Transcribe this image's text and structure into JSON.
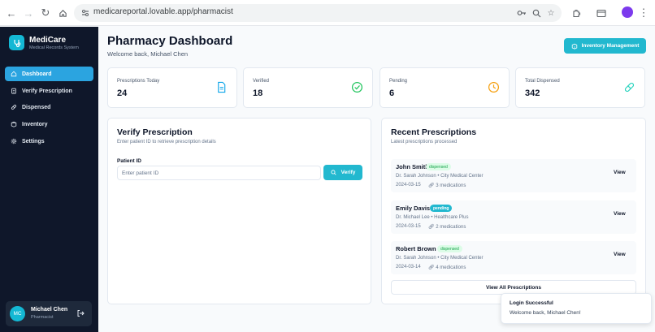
{
  "browser": {
    "url": "medicareportal.lovable.app/pharmacist"
  },
  "brand": {
    "name": "MediCare",
    "subtitle": "Medical Records System",
    "accent": "#22b8cf"
  },
  "sidebar": {
    "items": [
      {
        "label": "Dashboard",
        "icon": "home-icon",
        "active": true
      },
      {
        "label": "Verify Prescription",
        "icon": "clipboard-icon",
        "active": false
      },
      {
        "label": "Dispensed",
        "icon": "pill-icon",
        "active": false
      },
      {
        "label": "Inventory",
        "icon": "box-icon",
        "active": false
      },
      {
        "label": "Settings",
        "icon": "gear-icon",
        "active": false
      }
    ],
    "user": {
      "initials": "MC",
      "name": "Michael Chen",
      "role": "Pharmacist"
    }
  },
  "header": {
    "title": "Pharmacy Dashboard",
    "subtitle": "Welcome back, Michael Chen",
    "inventory_button": "Inventory Management"
  },
  "stats": [
    {
      "label": "Prescriptions Today",
      "value": "24",
      "icon": "document-icon",
      "color": "#0ea5e9"
    },
    {
      "label": "Verified",
      "value": "18",
      "icon": "check-circle-icon",
      "color": "#22c55e"
    },
    {
      "label": "Pending",
      "value": "6",
      "icon": "clock-icon",
      "color": "#f59e0b"
    },
    {
      "label": "Total Dispensed",
      "value": "342",
      "icon": "pill-icon",
      "color": "#2dd4bf"
    }
  ],
  "verify": {
    "title": "Verify Prescription",
    "subtitle": "Enter patient ID to retrieve prescription details",
    "field_label": "Patient ID",
    "placeholder": "Enter patient ID",
    "button": "Verify"
  },
  "recent": {
    "title": "Recent Prescriptions",
    "subtitle": "Latest prescriptions processed",
    "items": [
      {
        "patient": "John Smith",
        "status": "dispensed",
        "doctor": "Dr. Sarah Johnson • City Medical Center",
        "date": "2024-03-15",
        "meds": "3 medications",
        "view": "View"
      },
      {
        "patient": "Emily Davis",
        "status": "pending",
        "doctor": "Dr. Michael Lee • Healthcare Plus",
        "date": "2024-03-15",
        "meds": "2 medications",
        "view": "View"
      },
      {
        "patient": "Robert Brown",
        "status": "dispensed",
        "doctor": "Dr. Sarah Johnson • City Medical Center",
        "date": "2024-03-14",
        "meds": "4 medications",
        "view": "View"
      }
    ],
    "view_all": "View All Prescriptions"
  },
  "toast": {
    "title": "Login Successful",
    "message": "Welcome back, Michael Chen!"
  }
}
